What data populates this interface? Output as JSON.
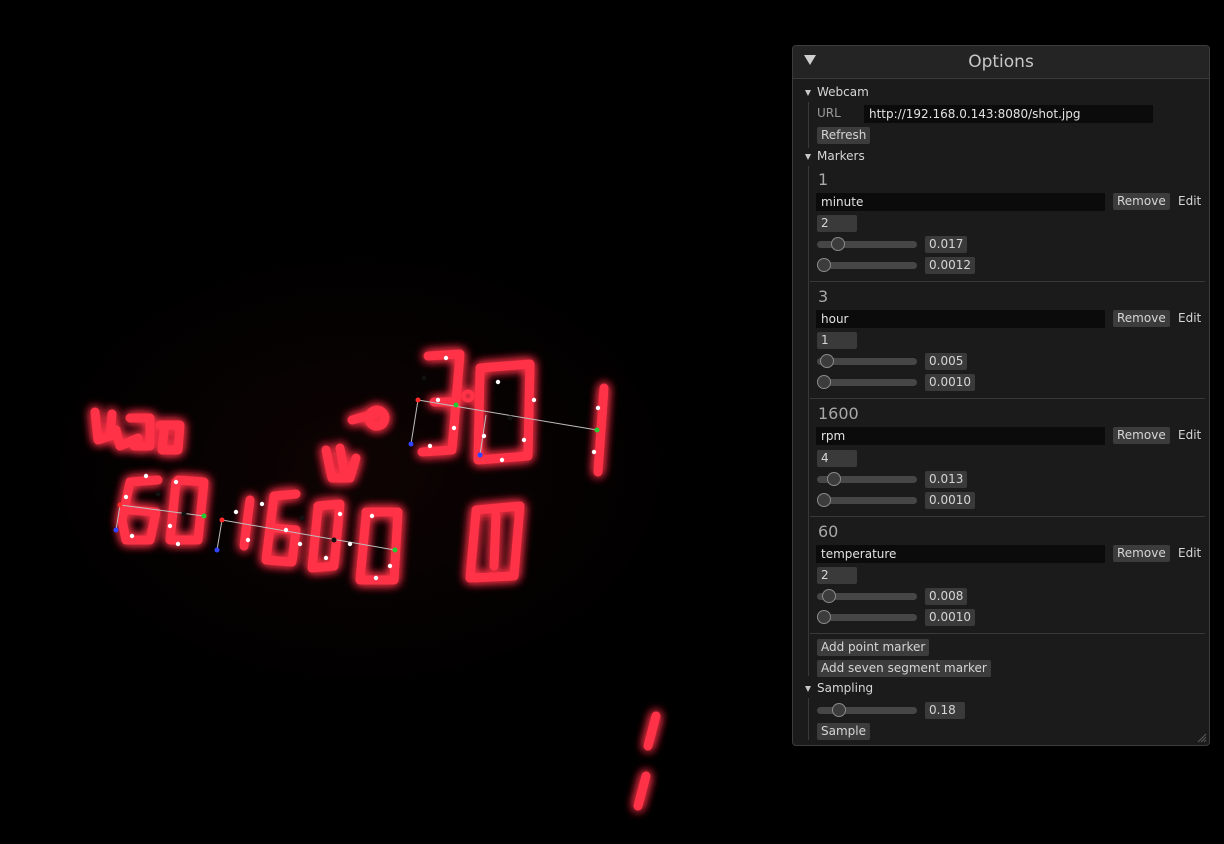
{
  "window": {
    "title": "Options"
  },
  "webcam": {
    "header": "Webcam",
    "url_label": "URL",
    "url_value": "http://192.168.0.143:8080/shot.jpg",
    "refresh_label": "Refresh"
  },
  "markers": {
    "header": "Markers",
    "items": [
      {
        "reading": "1",
        "name": "minute",
        "digits": "2",
        "slider1": {
          "value": "0.017",
          "fraction": 0.17
        },
        "slider2": {
          "value": "0.0012",
          "fraction": 0.0
        },
        "remove_label": "Remove",
        "edit_label": "Edit"
      },
      {
        "reading": "3",
        "name": "hour",
        "digits": "1",
        "slider1": {
          "value": "0.005",
          "fraction": 0.05
        },
        "slider2": {
          "value": "0.0010",
          "fraction": 0.0
        },
        "remove_label": "Remove",
        "edit_label": "Edit"
      },
      {
        "reading": "1600",
        "name": "rpm",
        "digits": "4",
        "slider1": {
          "value": "0.013",
          "fraction": 0.13
        },
        "slider2": {
          "value": "0.0010",
          "fraction": 0.0
        },
        "remove_label": "Remove",
        "edit_label": "Edit"
      },
      {
        "reading": "60",
        "name": "temperature",
        "digits": "2",
        "slider1": {
          "value": "0.008",
          "fraction": 0.08
        },
        "slider2": {
          "value": "0.0010",
          "fraction": 0.0
        },
        "remove_label": "Remove",
        "edit_label": "Edit"
      }
    ],
    "add_point_label": "Add point marker",
    "add_seven_segment_label": "Add seven segment marker"
  },
  "sampling": {
    "header": "Sampling",
    "slider": {
      "value": "0.18",
      "fraction": 0.18
    },
    "sample_label": "Sample"
  },
  "colors": {
    "panel_bg": "#1b1b1b",
    "title_bg": "#242424",
    "button_bg": "#3c3c3c",
    "field_bg": "#0b0b0b",
    "display_red": "#ff2a3d"
  }
}
